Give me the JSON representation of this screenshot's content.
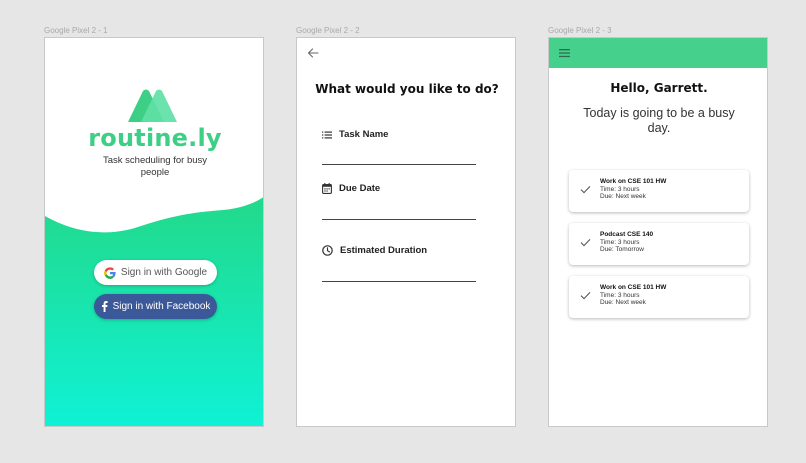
{
  "frames": [
    {
      "label": "Google Pixel 2 - 1"
    },
    {
      "label": "Google Pixel 2 - 2"
    },
    {
      "label": "Google Pixel 2 - 3"
    }
  ],
  "login": {
    "brand": "routine.ly",
    "tagline": "Task scheduling for busy people",
    "google_label": "Sign in with Google",
    "facebook_label": "Sign in with Facebook"
  },
  "new_task": {
    "title": "What would you like to do?",
    "fields": [
      {
        "label": "Task Name",
        "icon": "list-icon"
      },
      {
        "label": "Due Date",
        "icon": "calendar-icon"
      },
      {
        "label": "Estimated Duration",
        "icon": "clock-icon"
      }
    ]
  },
  "home": {
    "greeting": "Hello, Garrett.",
    "subtitle": "Today is going to be a busy day.",
    "tasks": [
      {
        "title": "Work on CSE 101 HW",
        "time": "Time: 3 hours",
        "due": "Due: Next week"
      },
      {
        "title": "Podcast CSE 140",
        "time": "Time: 3 hours",
        "due": "Due: Tomorrow"
      },
      {
        "title": "Work on CSE 101 HW",
        "time": "Time: 3 hours",
        "due": "Due: Next week"
      }
    ]
  },
  "colors": {
    "brand_green": "#3ecf86",
    "appbar_green": "#45d18c",
    "gradient_top": "#22d98a",
    "gradient_bottom": "#0ff2d6",
    "facebook_blue": "#3b5998"
  }
}
